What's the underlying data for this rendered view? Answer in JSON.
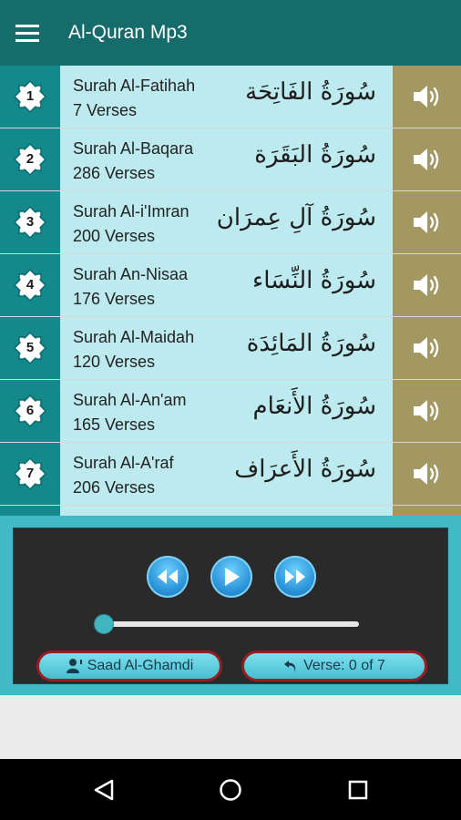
{
  "app_bar": {
    "title": "Al-Quran Mp3",
    "menu_icon": "hamburger-menu-icon"
  },
  "surahs": [
    {
      "number": "1",
      "name": "Surah Al-Fatihah",
      "verses": "7 Verses",
      "arabic": "سُورَةُ الفَاتِحَة"
    },
    {
      "number": "2",
      "name": "Surah Al-Baqara",
      "verses": "286 Verses",
      "arabic": "سُورَةُ البَقَرَة"
    },
    {
      "number": "3",
      "name": "Surah Al-i'Imran",
      "verses": "200 Verses",
      "arabic": "سُورَةُ آلِ عِمرَان"
    },
    {
      "number": "4",
      "name": "Surah An-Nisaa",
      "verses": "176 Verses",
      "arabic": "سُورَةُ النِّسَاء"
    },
    {
      "number": "5",
      "name": "Surah Al-Maidah",
      "verses": "120 Verses",
      "arabic": "سُورَةُ المَائِدَة"
    },
    {
      "number": "6",
      "name": "Surah Al-An'am",
      "verses": "165 Verses",
      "arabic": "سُورَةُ الأَنعَام"
    },
    {
      "number": "7",
      "name": "Surah Al-A'raf",
      "verses": "206 Verses",
      "arabic": "سُورَةُ الأَعرَاف"
    }
  ],
  "player": {
    "reciter_label": "Saad Al-Ghamdi",
    "verse_label": "Verse: 0 of 7",
    "progress": 0,
    "icons": [
      "rewind-icon",
      "play-icon",
      "fast-forward-icon",
      "user-icon",
      "repeat-icon"
    ]
  },
  "nav": {
    "icons": [
      "back-icon",
      "home-icon",
      "recents-icon"
    ]
  },
  "colors": {
    "app_bar": "#166b6b",
    "number_column": "#14898b",
    "info_column": "#bdeaef",
    "play_column": "#a39862",
    "player_frame": "#41b9c6",
    "pill_border": "#9a1d24"
  }
}
